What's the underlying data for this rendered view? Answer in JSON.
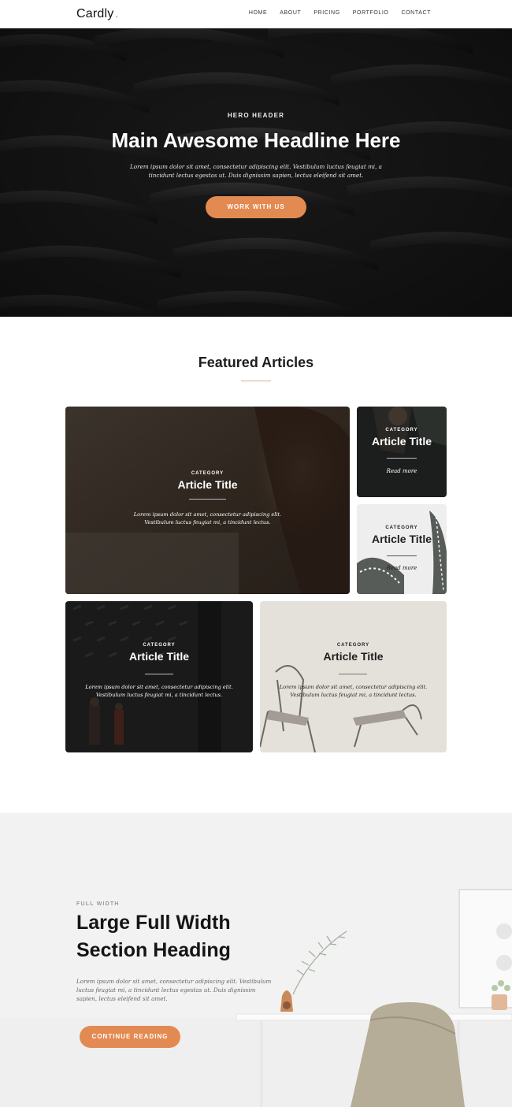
{
  "colors": {
    "accent": "#e38a52",
    "hero_bg": "#1c1c1c",
    "section_bg": "#efefef"
  },
  "nav": {
    "logo": "Cardly",
    "logo_dot": ".",
    "links": [
      "HOME",
      "ABOUT",
      "PRICING",
      "PORTFOLIO",
      "CONTACT"
    ]
  },
  "hero": {
    "eyebrow": "HERO HEADER",
    "title": "Main Awesome Headline Here",
    "text": "Lorem ipsum dolor sit amet, consectetur adipiscing elit. Vestibulum luctus feugiat mi, a tincidunt lectus egestas ut. Duis dignissim sapien, lectus eleifend sit amet.",
    "button": "WORK WITH US"
  },
  "featured": {
    "title": "Featured Articles",
    "cards": [
      {
        "category": "CATEGORY",
        "title": "Article Title",
        "text": "Lorem ipsum dolor sit amet, consectetur adipiscing elit. Vestibulum luctus feugiat mi, a tincidunt lectus."
      },
      {
        "category": "CATEGORY",
        "title": "Article Title",
        "more": "Read more"
      },
      {
        "category": "CATEGORY",
        "title": "Article Title",
        "more": "Read more"
      },
      {
        "category": "CATEGORY",
        "title": "Article Title",
        "text": "Lorem ipsum dolor sit amet, consectetur adipiscing elit. Vestibulum luctus feugiat mi, a tincidunt lectus."
      },
      {
        "category": "CATEGORY",
        "title": "Article Title",
        "text": "Lorem ipsum dolor sit amet, consectetur adipiscing elit. Vestibulum luctus feugiat mi, a tincidunt lectus."
      }
    ]
  },
  "full_width": {
    "eyebrow": "FULL WIDTH",
    "heading_line1": "Large Full Width",
    "heading_line2": "Section Heading",
    "text": "Lorem ipsum dolor sit amet, consectetur adipiscing elit. Vestibulum luctus feugiat mi, a tincidunt lectus egestas ut. Duis dignissim sapien, lectus eleifend sit amet.",
    "button": "CONTINUE READING"
  }
}
